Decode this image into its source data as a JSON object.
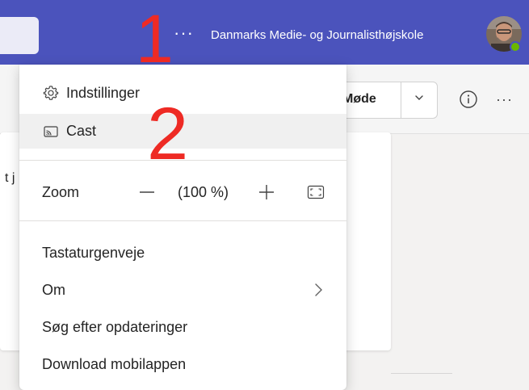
{
  "topbar": {
    "more_label": "···",
    "org_name": "Danmarks Medie- og Journalisthøjskole",
    "avatar_icon": "user-avatar",
    "presence_status": "available"
  },
  "toolbar": {
    "meeting_label": "Møde",
    "info_icon": "info-icon",
    "more_label": "···"
  },
  "background": {
    "truncated_text": "t j"
  },
  "menu": {
    "settings": {
      "icon": "gear-icon",
      "label": "Indstillinger"
    },
    "cast": {
      "icon": "cast-icon",
      "label": "Cast"
    },
    "zoom": {
      "label": "Zoom",
      "level": "(100 %)"
    },
    "shortcuts": {
      "label": "Tastaturgenveje"
    },
    "about": {
      "label": "Om"
    },
    "updates": {
      "label": "Søg efter opdateringer"
    },
    "mobile": {
      "label": "Download mobilappen"
    }
  },
  "annotations": {
    "one": "1",
    "two": "2"
  },
  "colors": {
    "header_bg": "#4b53bc",
    "annotation_red": "#ee2a24",
    "presence_green": "#6bb700",
    "hover_bg": "#f0f0f0"
  }
}
